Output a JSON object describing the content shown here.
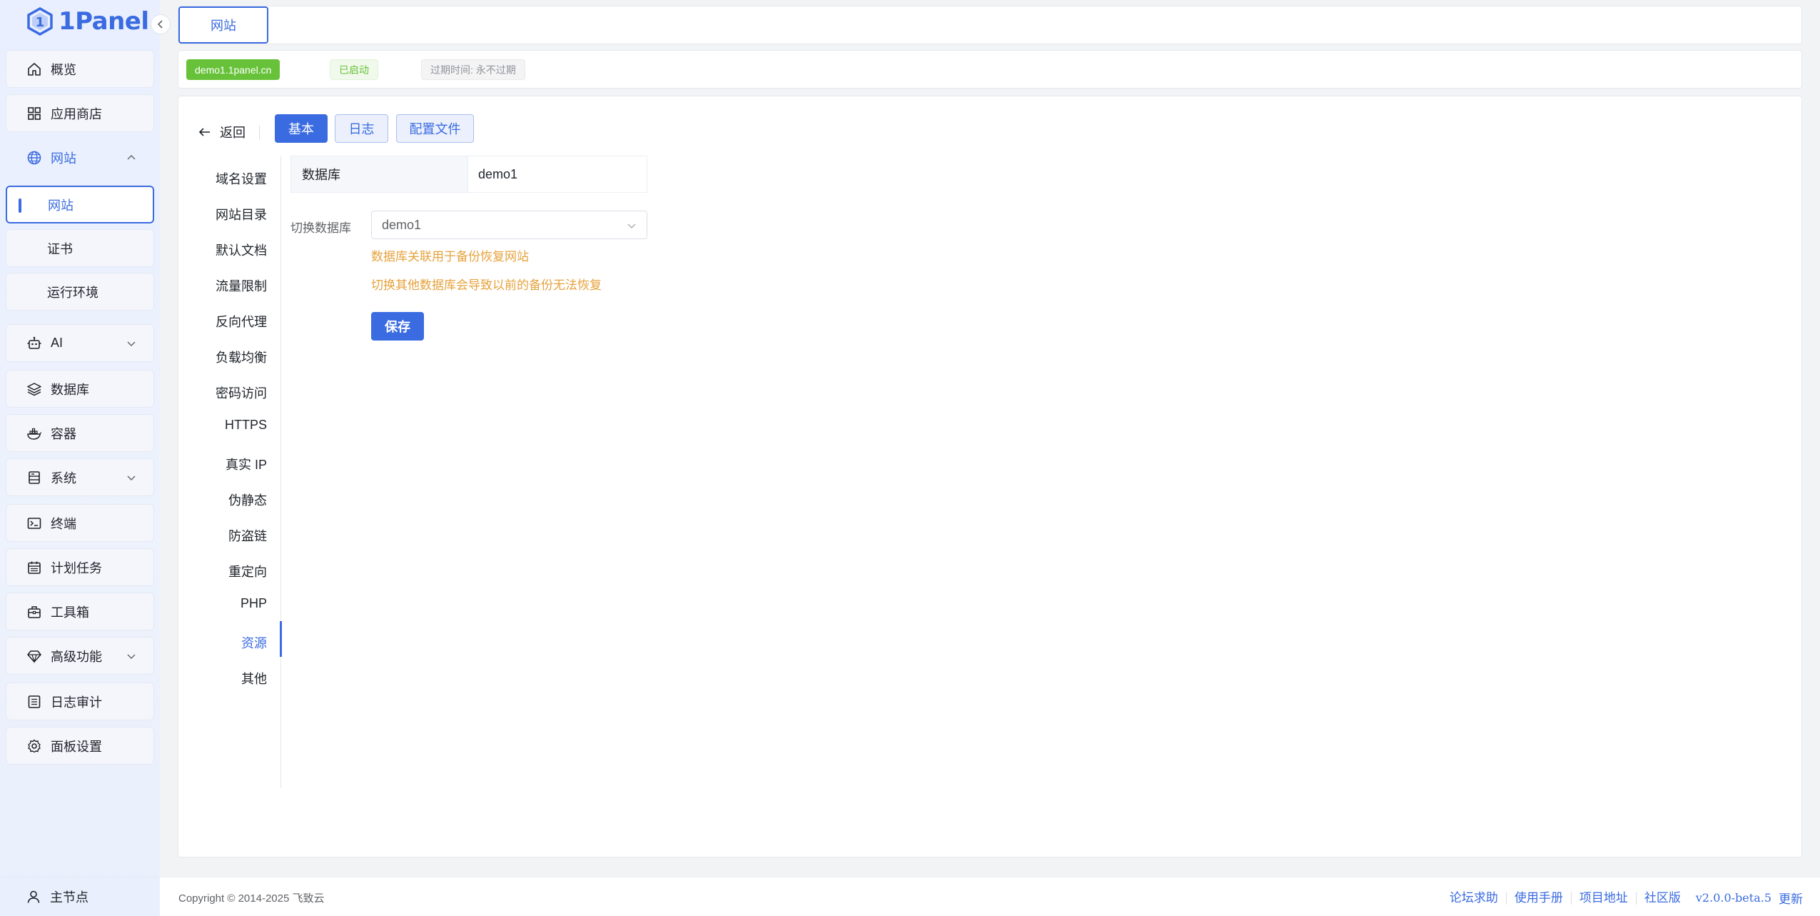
{
  "brand": {
    "name": "1Panel",
    "accent": "#3a6be0"
  },
  "sidebar": {
    "items": [
      {
        "label": "概览",
        "icon": "home-icon"
      },
      {
        "label": "应用商店",
        "icon": "grid-icon"
      },
      {
        "label": "网站",
        "icon": "globe-icon",
        "expanded": true
      },
      {
        "label": "AI",
        "icon": "robot-icon"
      },
      {
        "label": "数据库",
        "icon": "layers-icon"
      },
      {
        "label": "容器",
        "icon": "docker-icon"
      },
      {
        "label": "系统",
        "icon": "server-icon"
      },
      {
        "label": "终端",
        "icon": "terminal-icon"
      },
      {
        "label": "计划任务",
        "icon": "calendar-icon"
      },
      {
        "label": "工具箱",
        "icon": "toolbox-icon"
      },
      {
        "label": "高级功能",
        "icon": "diamond-icon"
      },
      {
        "label": "日志审计",
        "icon": "log-icon"
      },
      {
        "label": "面板设置",
        "icon": "gear-icon"
      }
    ],
    "website_sub": [
      {
        "label": "网站",
        "active": true
      },
      {
        "label": "证书"
      },
      {
        "label": "运行环境"
      }
    ],
    "node": "主节点"
  },
  "tabs": [
    {
      "label": "网站"
    }
  ],
  "info": {
    "domain": "demo1.1panel.cn",
    "status": "已启动",
    "expire": "过期时间: 永不过期"
  },
  "header": {
    "back": "返回",
    "buttons": [
      "基本",
      "日志",
      "配置文件"
    ]
  },
  "menu": [
    "域名设置",
    "网站目录",
    "默认文档",
    "流量限制",
    "反向代理",
    "负载均衡",
    "密码访问",
    "HTTPS",
    "真实 IP",
    "伪静态",
    "防盗链",
    "重定向",
    "PHP",
    "资源",
    "其他"
  ],
  "content": {
    "desc_label": "数据库",
    "desc_value": "demo1",
    "switch_label": "切换数据库",
    "select_value": "demo1",
    "warn1": "数据库关联用于备份恢复网站",
    "warn2": "切换其他数据库会导致以前的备份无法恢复",
    "save": "保存"
  },
  "footer": {
    "copyright": "Copyright © 2014-2025 飞致云",
    "links": [
      "论坛求助",
      "使用手册",
      "项目地址",
      "社区版"
    ],
    "version": "v2.0.0-beta.5",
    "update": "更新"
  }
}
